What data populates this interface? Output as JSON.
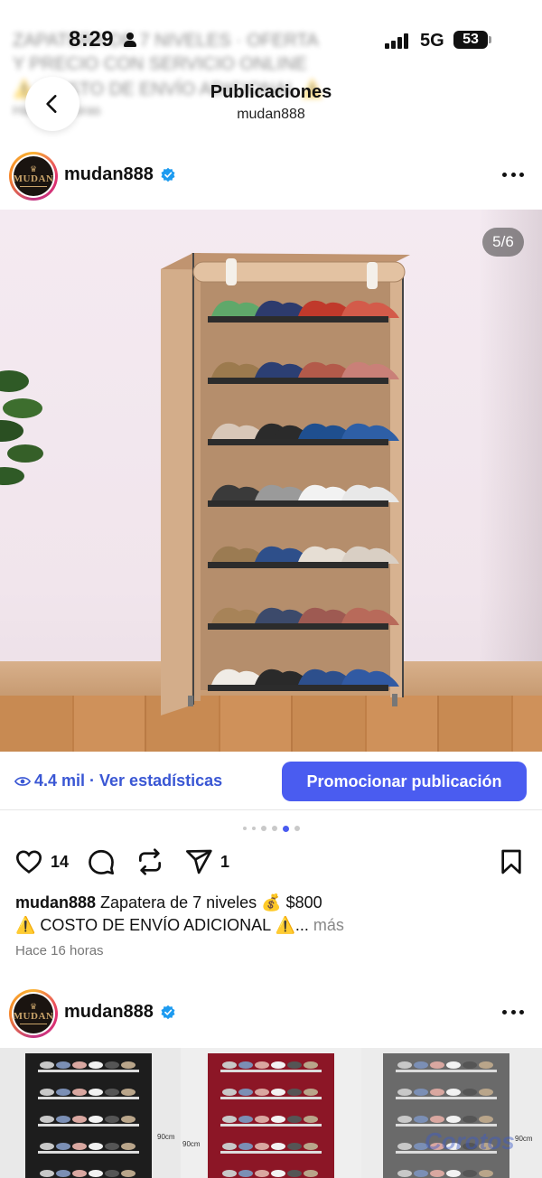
{
  "status_bar": {
    "time": "8:29",
    "network": "5G",
    "battery": "53"
  },
  "header": {
    "title": "Publicaciones",
    "subtitle": "mudan888",
    "back_icon": "chevron-left-icon"
  },
  "post": {
    "username": "mudan888",
    "avatar_text": "MUDAN",
    "image_counter": "5/6",
    "views_text": "4.4 mil · Ver estadísticas",
    "promote_button": "Promocionar publicación",
    "carousel": {
      "count": 6,
      "active_index": 4
    },
    "likes": "14",
    "shares": "1",
    "caption_username": "mudan888",
    "caption_line1": " Zapatera de 7 niveles 💰 $800",
    "caption_line2": "⚠️ COSTO DE ENVÍO ADICIONAL ⚠️...",
    "caption_more": " más",
    "time_ago": "Hace 16 horas"
  },
  "next_post": {
    "username": "mudan888",
    "avatar_text": "MUDAN",
    "size_labels": [
      "90cm",
      "90cm",
      "90cm"
    ],
    "watermark": "Corotos"
  },
  "colors": {
    "accent": "#4a5cf0",
    "link": "#3a57d4",
    "verified": "#1d9bf0",
    "rack_fabric": "#d8b493"
  }
}
